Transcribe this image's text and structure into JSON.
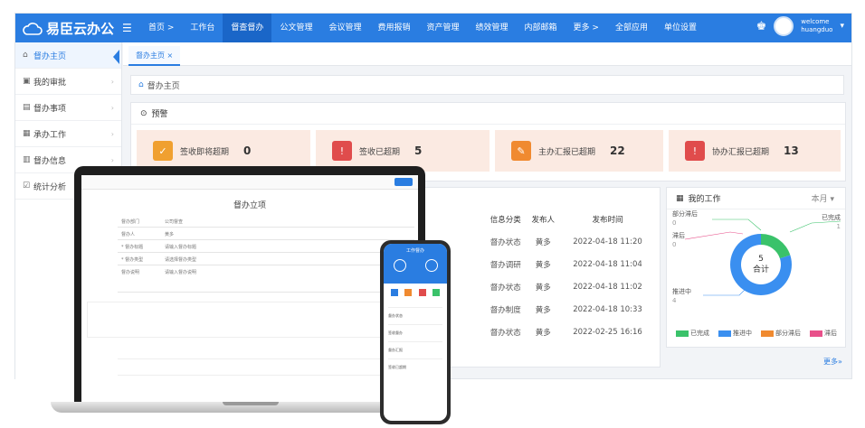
{
  "app": {
    "name": "易臣云办公",
    "menu_icon": "☰"
  },
  "nav": [
    "首页 >",
    "工作台",
    "督查督办",
    "公文管理",
    "会议管理",
    "费用报销",
    "资产管理",
    "绩效管理",
    "内部邮箱",
    "更多 >",
    "全部应用",
    "单位设置"
  ],
  "user": {
    "welcome": "welcome",
    "name": "huangduo"
  },
  "sidebar": [
    "督办主页",
    "我的审批",
    "督办事项",
    "承办工作",
    "督办信息",
    "统计分析"
  ],
  "tab": "督办主页 ×",
  "breadcrumb": "督办主页",
  "alert": {
    "title": "预警",
    "cards": [
      {
        "label": "签收即将超期",
        "value": "0"
      },
      {
        "label": "签收已超期",
        "value": "5"
      },
      {
        "label": "主办汇报已超期",
        "value": "22"
      },
      {
        "label": "协办汇报已超期",
        "value": "13"
      }
    ]
  },
  "colors": {
    "brand": "#2a7de1",
    "card1": "#f0a030",
    "card2": "#e04c4c",
    "card3": "#f08a30",
    "card4": "#e04c4c"
  },
  "info_table": {
    "headers": [
      "信息分类",
      "发布人",
      "发布时间"
    ],
    "rows": [
      [
        "督办状态",
        "黄多",
        "2022-04-18 11:20"
      ],
      [
        "督办调研",
        "黄多",
        "2022-04-18 11:04"
      ],
      [
        "督办状态",
        "黄多",
        "2022-04-18 11:02"
      ],
      [
        "督办制度",
        "黄多",
        "2022-04-18 10:33"
      ],
      [
        "督办状态",
        "黄多",
        "2022-02-25 16:16"
      ]
    ]
  },
  "more": "更多»",
  "mywork": {
    "title": "我的工作",
    "period": "本月 ▾",
    "center_count": "5",
    "center_label": "合计",
    "labels": {
      "partial": "部分滞后",
      "partial_v": "0",
      "lag": "滞后",
      "lag_v": "0",
      "done": "已完成",
      "done_v": "1",
      "progress": "推进中",
      "progress_v": "4"
    },
    "legend": [
      "已完成",
      "推进中",
      "部分滞后",
      "滞后"
    ]
  },
  "chart_data": {
    "type": "pie",
    "title": "",
    "categories": [
      "已完成",
      "推进中",
      "部分滞后",
      "滞后"
    ],
    "values": [
      1,
      4,
      0,
      0
    ],
    "colors": [
      "#3ac26a",
      "#3a8ff0",
      "#f08a30",
      "#e8508a"
    ]
  },
  "laptop": {
    "form_title": "督办立项",
    "fields": [
      "督办部门",
      "督办人",
      "* 督办标题",
      "* 督办类型",
      "督办说明"
    ],
    "values": [
      "公司督查",
      "黄多",
      "请输入督办标题",
      "请选择督办类型",
      "请输入督办说明"
    ]
  },
  "phone": {
    "title": "工作督办",
    "items": [
      "督办状态",
      "签收督办",
      "督办汇报",
      "签收已超期"
    ]
  }
}
